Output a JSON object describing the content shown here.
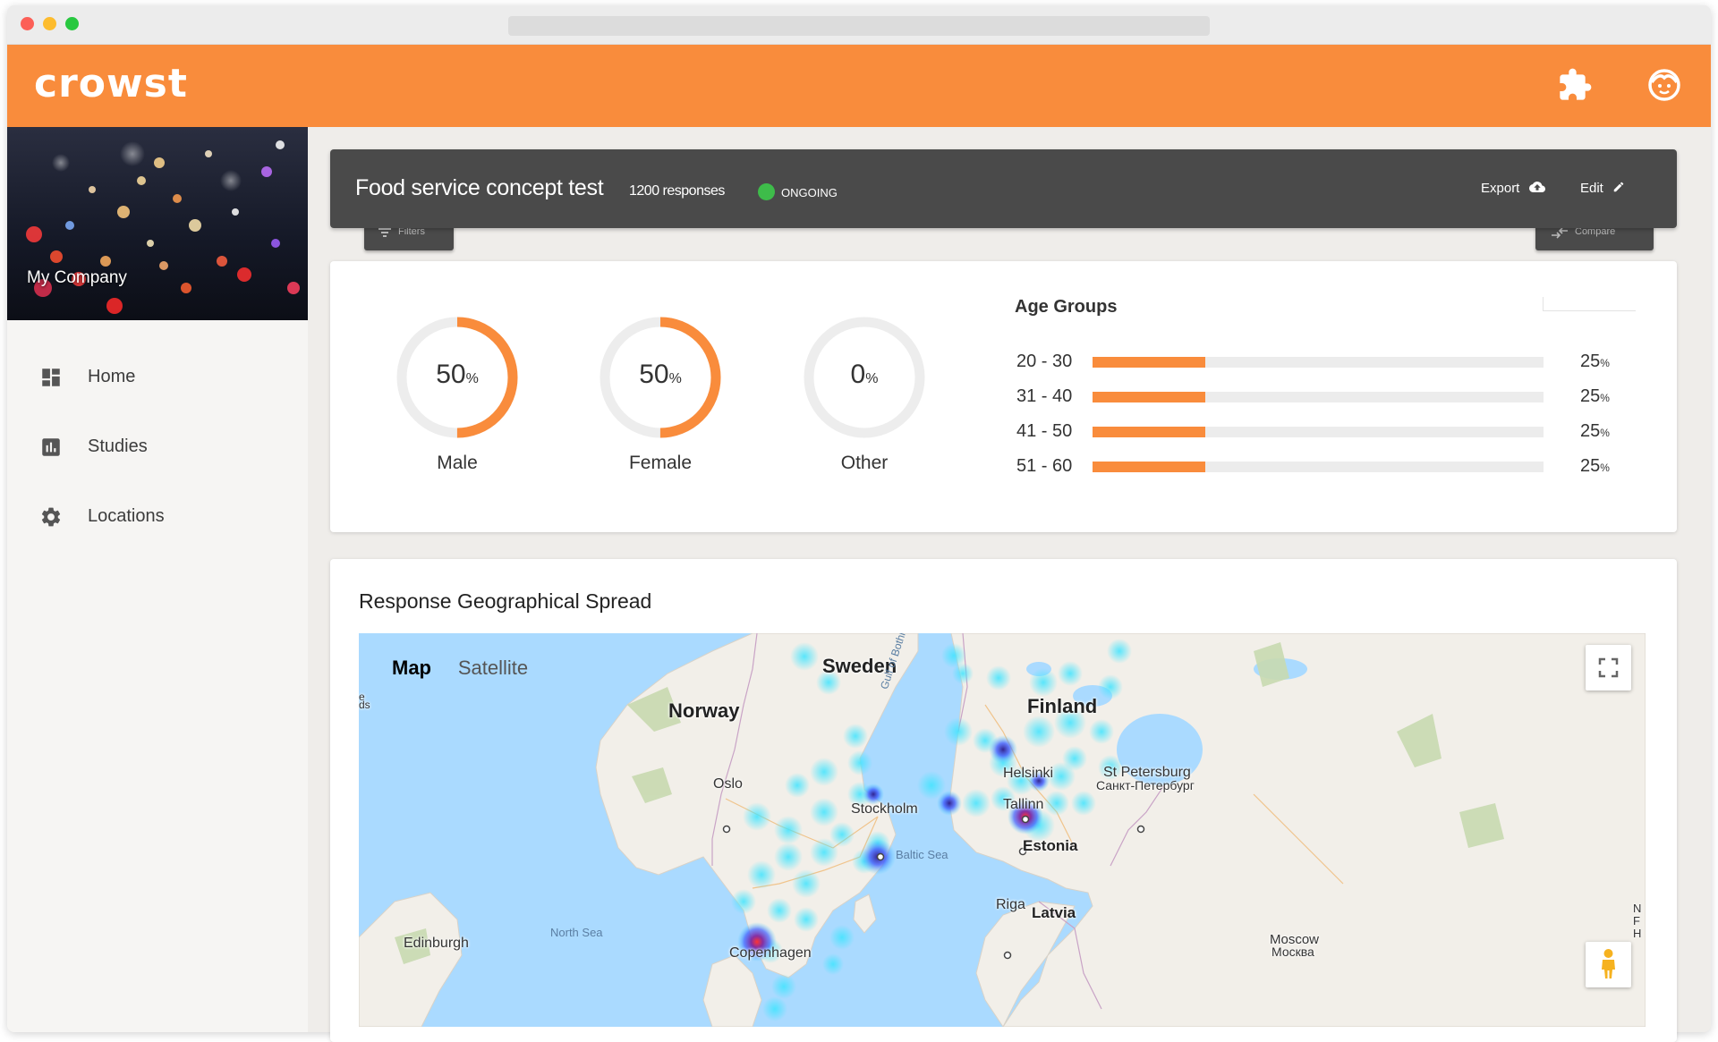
{
  "app": {
    "logo": "crowst",
    "company_name": "My Company"
  },
  "header_icons": [
    "puzzle-piece-icon",
    "face-icon"
  ],
  "sidebar": {
    "items": [
      {
        "label": "Home",
        "icon": "dashboard-icon"
      },
      {
        "label": "Studies",
        "icon": "bar-chart-icon"
      },
      {
        "label": "Locations",
        "icon": "gear-icon"
      }
    ]
  },
  "study": {
    "title": "Food service concept test",
    "responses": "1200 responses",
    "status": "ONGOING",
    "status_color": "#3ebc4a",
    "export_label": "Export",
    "edit_label": "Edit",
    "filters_label": "Filters",
    "compare_label": "Compare"
  },
  "demographics": {
    "gender": [
      {
        "label": "Male",
        "value": "50",
        "unit": "%",
        "fraction": 0.5
      },
      {
        "label": "Female",
        "value": "50",
        "unit": "%",
        "fraction": 0.5
      },
      {
        "label": "Other",
        "value": "0",
        "unit": "%",
        "fraction": 0.0
      }
    ],
    "age_title": "Age Groups",
    "age_groups": [
      {
        "label": "20 - 30",
        "value": "25",
        "unit": "%",
        "fraction": 0.25
      },
      {
        "label": "31 - 40",
        "value": "25",
        "unit": "%",
        "fraction": 0.25
      },
      {
        "label": "41 - 50",
        "value": "25",
        "unit": "%",
        "fraction": 0.25
      },
      {
        "label": "51 - 60",
        "value": "25",
        "unit": "%",
        "fraction": 0.25
      }
    ]
  },
  "map": {
    "title": "Response Geographical Spread",
    "toggle_map": "Map",
    "toggle_satellite": "Satellite",
    "countries": [
      "Sweden",
      "Norway",
      "Finland",
      "Estonia",
      "Latvia"
    ],
    "cities": [
      "Oslo",
      "Stockholm",
      "Helsinki",
      "Tallinn",
      "St Petersburg",
      "Санкт-Петербург",
      "Riga",
      "Edinburgh",
      "Copenhagen",
      "Moscow",
      "Москва"
    ],
    "seas": [
      "North Sea",
      "Baltic Sea",
      "Gulf of Bothnia"
    ],
    "edge_labels": [
      "e",
      "ds",
      "N",
      "F",
      "H"
    ]
  },
  "colors": {
    "brand_orange": "#f98c3c",
    "header_dark": "#4a4a4a",
    "status_green": "#3ebc4a"
  }
}
